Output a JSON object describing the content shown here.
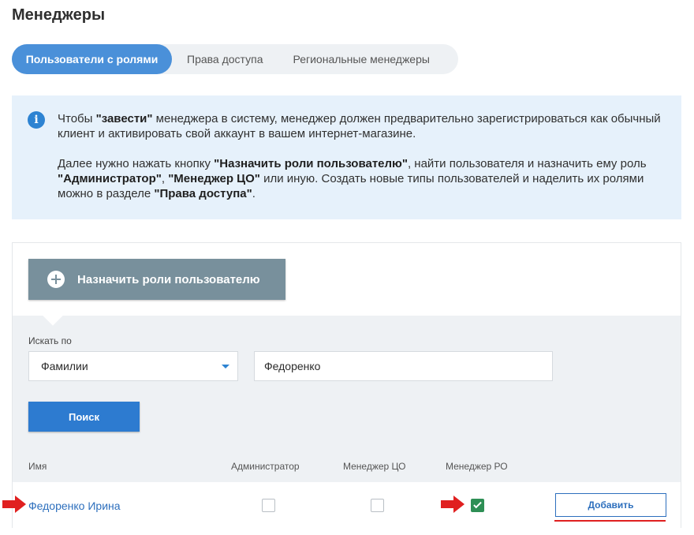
{
  "page": {
    "title": "Менеджеры"
  },
  "tabs": [
    {
      "label": "Пользователи с ролями",
      "active": true
    },
    {
      "label": "Права доступа",
      "active": false
    },
    {
      "label": "Региональные менеджеры",
      "active": false
    }
  ],
  "info": {
    "icon": "info-icon",
    "p1_a": "Чтобы ",
    "p1_b": "\"завести\"",
    "p1_c": " менеджера в систему, менеджер должен предварительно зарегистрироваться как обычный клиент и активировать свой аккаунт в вашем интернет-магазине.",
    "p2_a": "Далее нужно нажать кнопку ",
    "p2_b": "\"Назначить роли пользователю\"",
    "p2_c": ", найти пользователя и назначить ему роль ",
    "p2_d": "\"Администратор\"",
    "p2_e": ", ",
    "p2_f": "\"Менеджер ЦО\"",
    "p2_g": " или иную. Создать новые типы пользователей и наделить их ролями можно в разделе ",
    "p2_h": "\"Права доступа\"",
    "p2_i": "."
  },
  "assign": {
    "label": "Назначить роли пользователю"
  },
  "search": {
    "label": "Искать по",
    "field_value": "Фамилии",
    "query_value": "Федоренко",
    "button": "Поиск"
  },
  "table": {
    "headers": [
      "Имя",
      "Администратор",
      "Менеджер ЦО",
      "Менеджер РО"
    ],
    "rows": [
      {
        "name": "Федоренко Ирина",
        "admin": false,
        "manager_co": false,
        "manager_ro": true,
        "action": "Добавить"
      }
    ]
  },
  "colors": {
    "accent": "#4a90d9",
    "primary_button": "#2d7bd0",
    "assign_button": "#78909c",
    "check": "#2e8f55",
    "annotation": "#e02020"
  }
}
